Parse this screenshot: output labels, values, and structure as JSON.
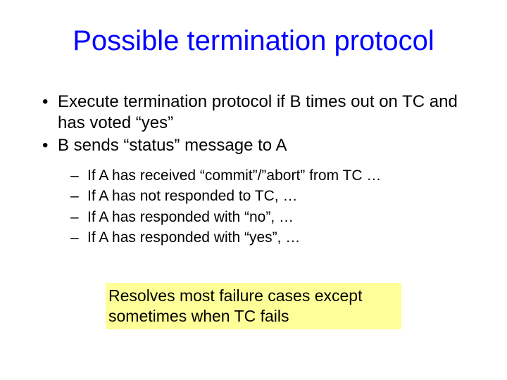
{
  "title": "Possible termination protocol",
  "bullets": [
    "Execute termination protocol if B times out on TC and has voted “yes”",
    "B sends “status” message to A"
  ],
  "subbullets": [
    "If A has received “commit”/”abort” from TC …",
    "If A has not responded to TC, …",
    "If A has responded with “no”, …",
    "If A has responded with “yes”, …"
  ],
  "callout": "Resolves most failure cases except sometimes when TC fails",
  "markers": {
    "level1": "•",
    "level2": "–"
  }
}
